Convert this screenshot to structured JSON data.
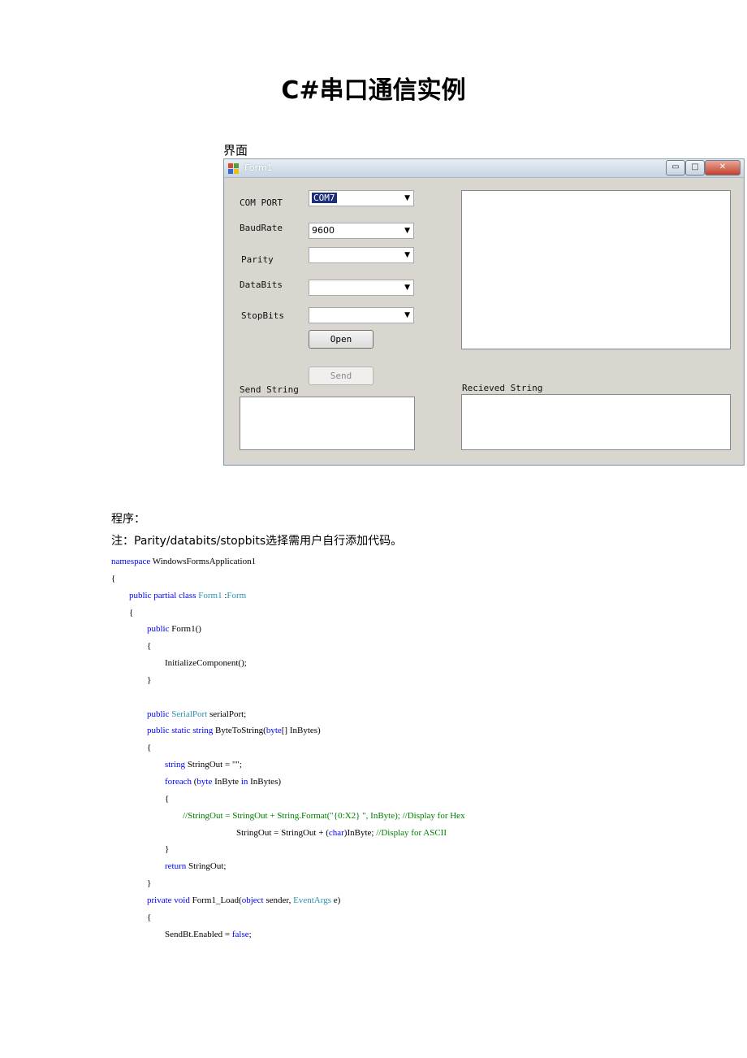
{
  "doc": {
    "title": "C#串口通信实例",
    "caption": "界面",
    "section_program": "程序：",
    "note": "注：Parity/databits/stopbits选择需用户自行添加代码。"
  },
  "window": {
    "title": "Form1",
    "labels": {
      "com_port": "COM PORT",
      "baud_rate": "BaudRate",
      "parity": "Parity",
      "data_bits": "DataBits",
      "stop_bits": "StopBits",
      "send_string": "Send String",
      "received_string": "Recieved String"
    },
    "fields": {
      "com_port": "COM7",
      "baud_rate": "9600",
      "parity": "",
      "data_bits": "",
      "stop_bits": ""
    },
    "buttons": {
      "open": "Open",
      "send": "Send",
      "minimize": "▭",
      "maximize": "□",
      "close": "✕"
    }
  },
  "code": [
    [
      {
        "t": "namespace",
        "c": "kw"
      },
      {
        "t": " WindowsFormsApplication1",
        "c": ""
      }
    ],
    [
      {
        "t": "{",
        "c": ""
      }
    ],
    [
      {
        "t": "        ",
        "c": ""
      },
      {
        "t": "public partial class",
        "c": "kw"
      },
      {
        "t": " ",
        "c": ""
      },
      {
        "t": "Form1",
        "c": "ty"
      },
      {
        "t": " :",
        "c": ""
      },
      {
        "t": "Form",
        "c": "ty"
      }
    ],
    [
      {
        "t": "        {",
        "c": ""
      }
    ],
    [
      {
        "t": "                ",
        "c": ""
      },
      {
        "t": "public",
        "c": "kw"
      },
      {
        "t": " Form1()",
        "c": ""
      }
    ],
    [
      {
        "t": "                {",
        "c": ""
      }
    ],
    [
      {
        "t": "                        InitializeComponent();",
        "c": ""
      }
    ],
    [
      {
        "t": "                }",
        "c": ""
      }
    ],
    [
      {
        "t": "",
        "c": ""
      }
    ],
    [
      {
        "t": "                ",
        "c": ""
      },
      {
        "t": "public",
        "c": "kw"
      },
      {
        "t": " ",
        "c": ""
      },
      {
        "t": "SerialPort",
        "c": "ty"
      },
      {
        "t": " serialPort;",
        "c": ""
      }
    ],
    [
      {
        "t": "                ",
        "c": ""
      },
      {
        "t": "public static string",
        "c": "kw"
      },
      {
        "t": " ByteToString(",
        "c": ""
      },
      {
        "t": "byte",
        "c": "kw"
      },
      {
        "t": "[] InBytes)",
        "c": ""
      }
    ],
    [
      {
        "t": "                {",
        "c": ""
      }
    ],
    [
      {
        "t": "                        ",
        "c": ""
      },
      {
        "t": "string",
        "c": "kw"
      },
      {
        "t": " StringOut = \"\";",
        "c": ""
      }
    ],
    [
      {
        "t": "                        ",
        "c": ""
      },
      {
        "t": "foreach",
        "c": "kw"
      },
      {
        "t": " (",
        "c": ""
      },
      {
        "t": "byte",
        "c": "kw"
      },
      {
        "t": " InByte ",
        "c": ""
      },
      {
        "t": "in",
        "c": "kw"
      },
      {
        "t": " InBytes)",
        "c": ""
      }
    ],
    [
      {
        "t": "                        {",
        "c": ""
      }
    ],
    [
      {
        "t": "                                ",
        "c": ""
      },
      {
        "t": "//StringOut = StringOut + String.Format(\"{0:X2} \", InByte); //Display for Hex",
        "c": "cm"
      }
    ],
    [
      {
        "t": "                                                        StringOut = StringOut + (",
        "c": ""
      },
      {
        "t": "char",
        "c": "kw"
      },
      {
        "t": ")InByte; ",
        "c": ""
      },
      {
        "t": "//Display for ASCII",
        "c": "cm"
      }
    ],
    [
      {
        "t": "                        }",
        "c": ""
      }
    ],
    [
      {
        "t": "                        ",
        "c": ""
      },
      {
        "t": "return",
        "c": "kw"
      },
      {
        "t": " StringOut;",
        "c": ""
      }
    ],
    [
      {
        "t": "                }",
        "c": ""
      }
    ],
    [
      {
        "t": "                ",
        "c": ""
      },
      {
        "t": "private void",
        "c": "kw"
      },
      {
        "t": " Form1_Load(",
        "c": ""
      },
      {
        "t": "object",
        "c": "kw"
      },
      {
        "t": " sender, ",
        "c": ""
      },
      {
        "t": "EventArgs",
        "c": "ty"
      },
      {
        "t": " e)",
        "c": ""
      }
    ],
    [
      {
        "t": "                {",
        "c": ""
      }
    ],
    [
      {
        "t": "                        SendBt.Enabled = ",
        "c": ""
      },
      {
        "t": "false",
        "c": "kw"
      },
      {
        "t": ";",
        "c": ""
      }
    ]
  ]
}
